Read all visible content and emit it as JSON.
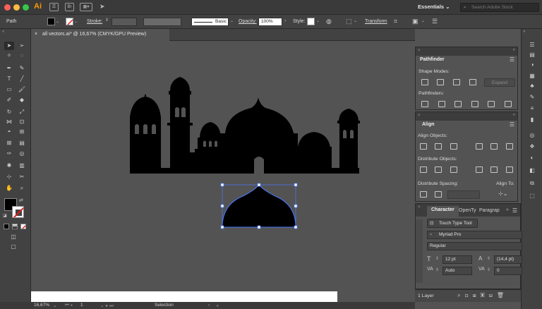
{
  "app": {
    "logo": "Ai",
    "bridge_label": "Br",
    "workspace": "Essentials",
    "search_placeholder": "Search Adobe Stock"
  },
  "control_bar": {
    "selection_type": "Path",
    "stroke_label": "Stroke:",
    "brush_label": "Basic",
    "opacity_label": "Opacity:",
    "opacity_value": "100%",
    "style_label": "Style:",
    "transform_label": "Transform"
  },
  "document_tab": {
    "close": "×",
    "title": "all vectors.ai* @ 16,67% (CMYK/GPU Preview)"
  },
  "status_bar": {
    "zoom": "16,67%",
    "artboard": "1",
    "tool": "Selection"
  },
  "pathfinder": {
    "tab": "Pathfinder",
    "shape_modes_label": "Shape Modes:",
    "expand_label": "Expand",
    "pathfinders_label": "Pathfinders:"
  },
  "align": {
    "tab": "Align",
    "align_objects_label": "Align Objects:",
    "distribute_objects_label": "Distribute Objects:",
    "distribute_spacing_label": "Distribute Spacing:",
    "align_to_label": "Align To:"
  },
  "character": {
    "tabs": [
      "Character",
      "OpenTy",
      "Paragrap"
    ],
    "touch_type": "Touch Type Tool",
    "font_family": "Myriad Pro",
    "font_style": "Regular",
    "size": "12 pt",
    "leading": "(14,4 pt)",
    "kerning": "Auto",
    "tracking": "0"
  },
  "layers": {
    "count": "1 Layer"
  },
  "colors": {
    "fill": "#000000",
    "selection": "#4a7bff",
    "artboard": "#ffffff"
  }
}
